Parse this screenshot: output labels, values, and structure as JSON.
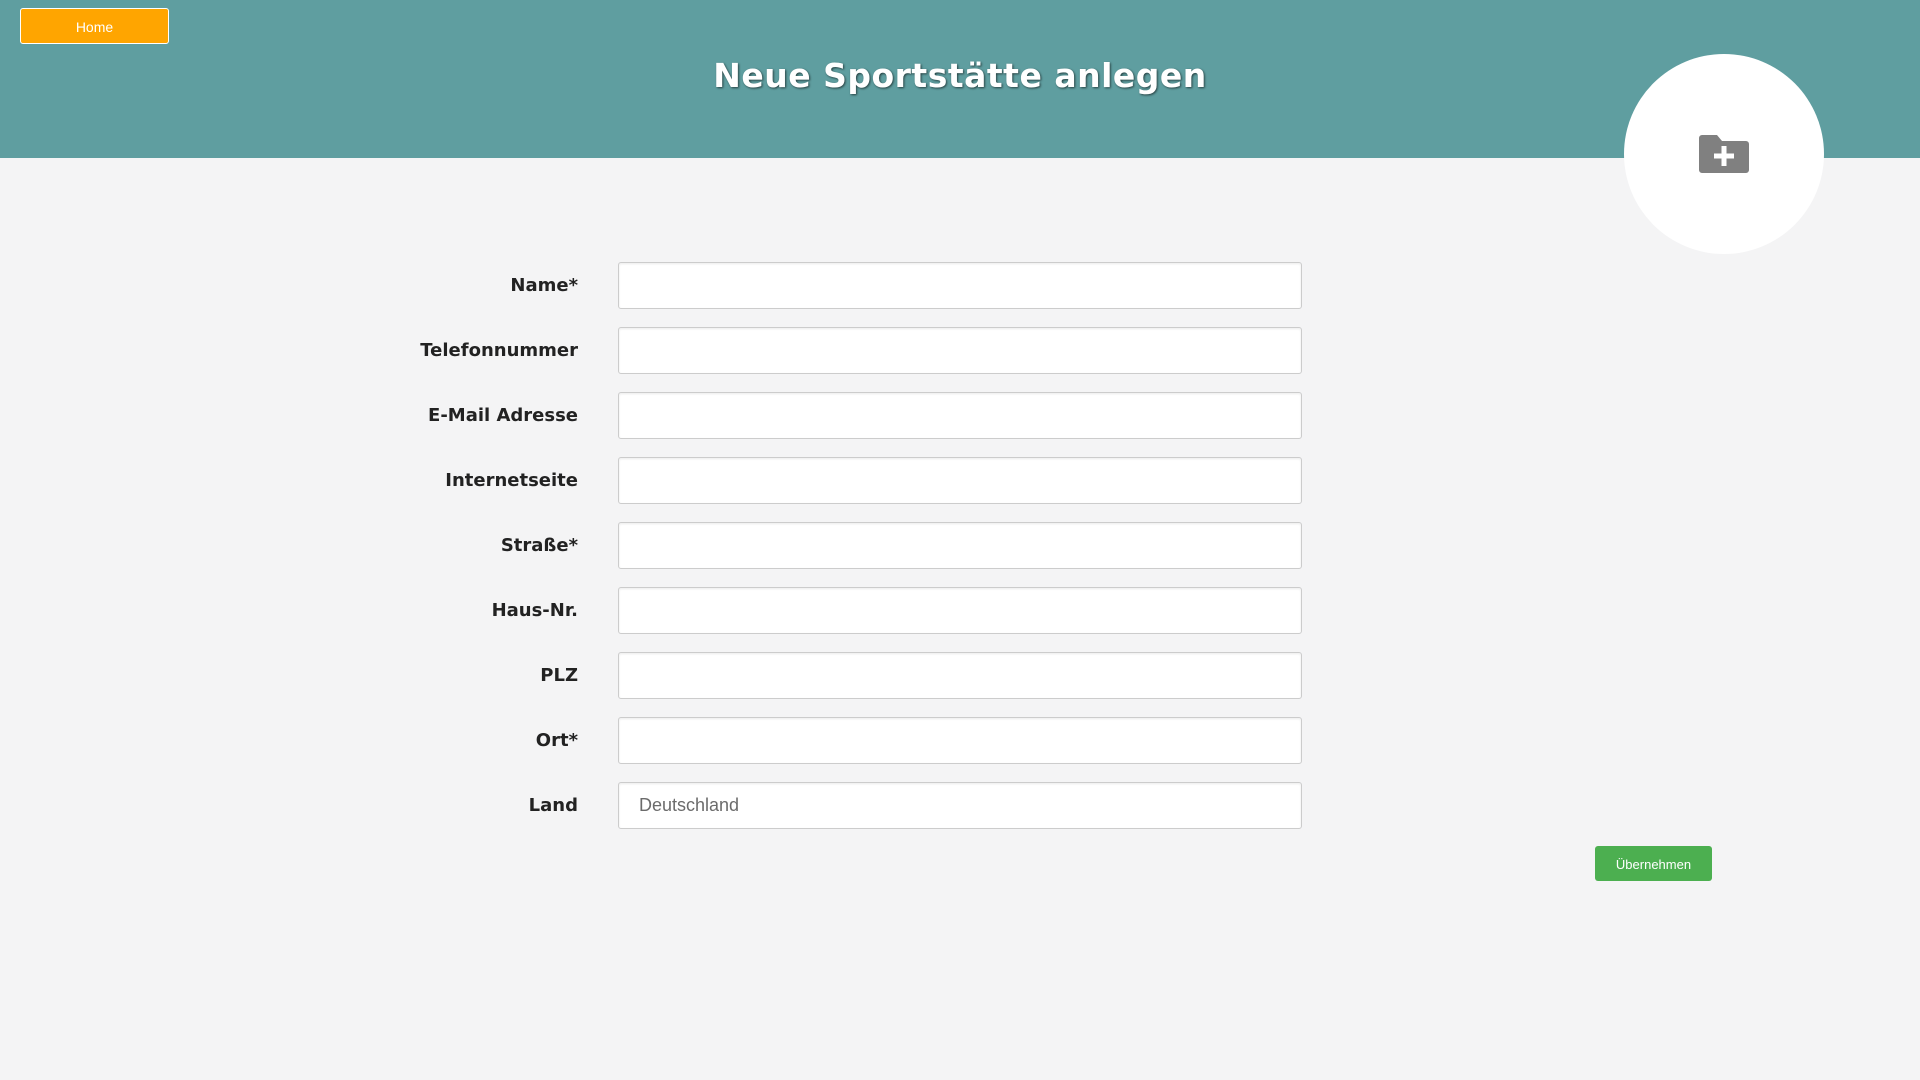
{
  "header": {
    "home_label": "Home",
    "title": "Neue Sportstätte anlegen",
    "upload_icon": "folder-plus-icon"
  },
  "colors": {
    "header_bg": "#5f9ea0",
    "home_button": "#ffa500",
    "submit_button": "#4caf50",
    "page_bg": "#f4f4f5"
  },
  "form": {
    "fields": [
      {
        "label": "Name*",
        "value": "",
        "placeholder": ""
      },
      {
        "label": "Telefonnummer",
        "value": "",
        "placeholder": ""
      },
      {
        "label": "E-Mail Adresse",
        "value": "",
        "placeholder": ""
      },
      {
        "label": "Internetseite",
        "value": "",
        "placeholder": ""
      },
      {
        "label": "Straße*",
        "value": "",
        "placeholder": ""
      },
      {
        "label": "Haus-Nr.",
        "value": "",
        "placeholder": ""
      },
      {
        "label": "PLZ",
        "value": "",
        "placeholder": ""
      },
      {
        "label": "Ort*",
        "value": "",
        "placeholder": ""
      },
      {
        "label": "Land",
        "value": "",
        "placeholder": "Deutschland"
      }
    ],
    "submit_label": "Übernehmen"
  }
}
